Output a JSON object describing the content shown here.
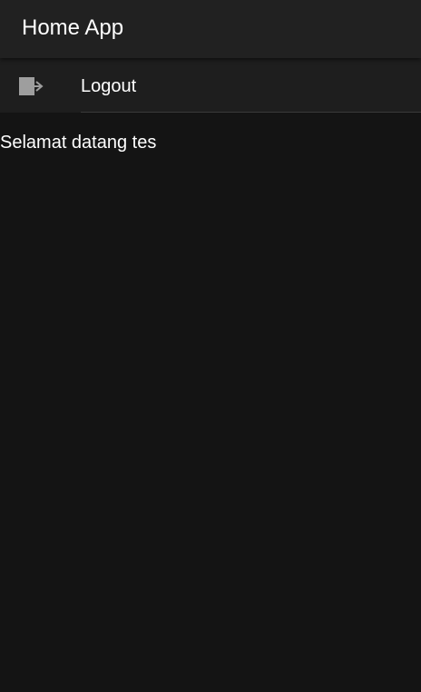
{
  "appbar": {
    "title": "Home App"
  },
  "menu": {
    "items": [
      {
        "label": "Logout",
        "icon": "logout-icon"
      }
    ]
  },
  "main": {
    "welcome_text": "Selamat datang tes"
  },
  "colors": {
    "background": "#141414",
    "appbar": "#212121",
    "menu_item": "#1e1e1e",
    "text": "#ffffff",
    "icon": "#9e9e9e"
  }
}
